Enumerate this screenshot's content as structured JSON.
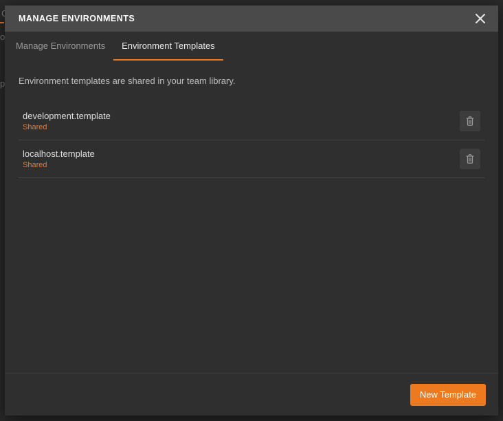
{
  "header": {
    "title": "MANAGE ENVIRONMENTS"
  },
  "tabs": [
    {
      "label": "Manage Environments",
      "active": false
    },
    {
      "label": "Environment Templates",
      "active": true
    }
  ],
  "body": {
    "description": "Environment templates are shared in your team library."
  },
  "templates": [
    {
      "name": "development.template",
      "status": "Shared"
    },
    {
      "name": "localhost.template",
      "status": "Shared"
    }
  ],
  "footer": {
    "new_template_label": "New Template"
  },
  "icons": {
    "close": "close-icon",
    "trash": "trash-icon"
  }
}
